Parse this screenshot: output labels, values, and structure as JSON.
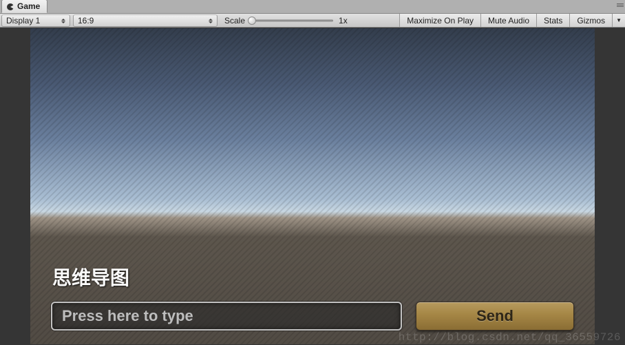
{
  "tab": {
    "label": "Game"
  },
  "toolbar": {
    "display_label": "Display 1",
    "aspect_label": "16:9",
    "scale_label": "Scale",
    "scale_value": "1x",
    "maximize_label": "Maximize On Play",
    "mute_label": "Mute Audio",
    "stats_label": "Stats",
    "gizmos_label": "Gizmos"
  },
  "game_ui": {
    "label_text": "思维导图",
    "input_placeholder": "Press here to type",
    "send_label": "Send"
  },
  "watermark": "http://blog.csdn.net/qq_36559726"
}
